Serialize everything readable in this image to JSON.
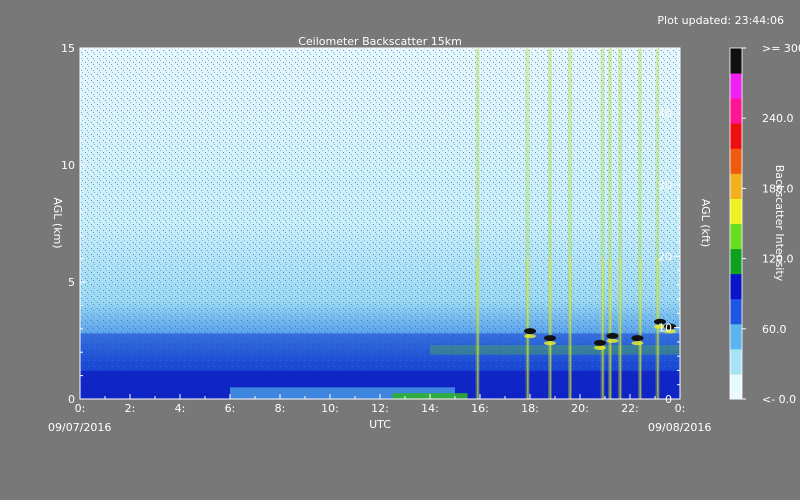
{
  "plot_updated": "Plot updated: 23:44:06",
  "chart_data": {
    "type": "heatmap",
    "title": "Ceilometer Backscatter 15km",
    "xlabel": "UTC",
    "ylabel_left": "AGL (km)",
    "ylabel_right": "AGL (kft)",
    "colorbar_label": "Backscatter Intensity",
    "date_start": "09/07/2016",
    "date_end": "09/08/2016",
    "x_ticks": [
      "0:",
      "2:",
      "4:",
      "6:",
      "8:",
      "10:",
      "12:",
      "14:",
      "16:",
      "18:",
      "20:",
      "22:",
      "0:"
    ],
    "x_range_hours": [
      0,
      24
    ],
    "y_range_km": [
      0,
      15
    ],
    "y_ticks_km": [
      "0",
      "5",
      "10",
      "15"
    ],
    "y_range_kft": [
      0,
      49.2
    ],
    "y_ticks_kft": [
      "0",
      "10",
      "20",
      "30",
      "40"
    ],
    "colorbar_range": [
      0,
      300
    ],
    "colorbar_ticks": [
      {
        "value": 0,
        "label": "<-   0.0"
      },
      {
        "value": 60,
        "label": "60.0"
      },
      {
        "value": 120,
        "label": "120.0"
      },
      {
        "value": 180,
        "label": "180.0"
      },
      {
        "value": 240,
        "label": "240.0"
      },
      {
        "value": 300,
        "label": ">= 300.0"
      }
    ],
    "colorscale": [
      "#e8fafc",
      "#a8e2f4",
      "#5cb4ec",
      "#1f58e0",
      "#0a14c8",
      "#10a020",
      "#66dd22",
      "#f0f020",
      "#f0b020",
      "#f05a10",
      "#ee1010",
      "#ff1493",
      "#ee22ee",
      "#101010"
    ],
    "features": {
      "boundary_layer_top_km": 2.8,
      "cloud_base_hits": [
        {
          "hour": 18.0,
          "height_km": 2.9
        },
        {
          "hour": 18.8,
          "height_km": 2.6
        },
        {
          "hour": 20.8,
          "height_km": 2.4
        },
        {
          "hour": 21.3,
          "height_km": 2.7
        },
        {
          "hour": 22.3,
          "height_km": 2.6
        },
        {
          "hour": 23.2,
          "height_km": 3.3
        },
        {
          "hour": 23.6,
          "height_km": 3.1
        }
      ],
      "precip_streak_hours": [
        15.9,
        17.9,
        18.8,
        19.6,
        20.9,
        21.2,
        21.6,
        22.4,
        23.1
      ]
    }
  }
}
